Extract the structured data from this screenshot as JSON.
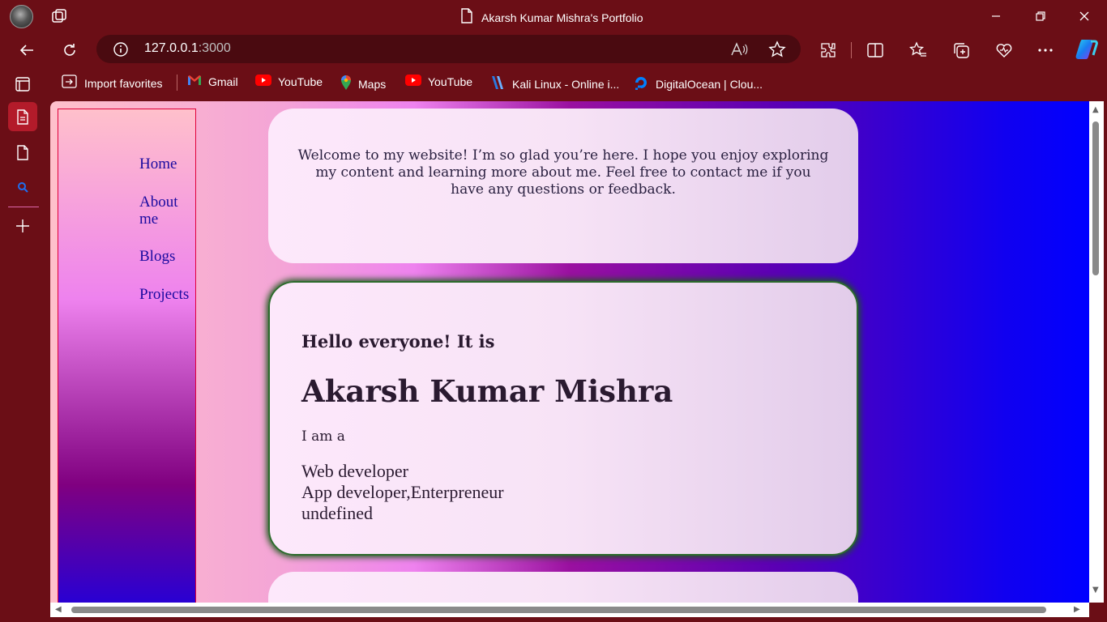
{
  "browser": {
    "tab_title": "Akarsh Kumar Mishra's Portfolio",
    "url_host": "127.0.0.1",
    "url_port": ":3000"
  },
  "favorites": [
    {
      "label": "Import favorites",
      "icon": "import-icon"
    },
    {
      "label": "Gmail",
      "icon": "gmail-icon"
    },
    {
      "label": "YouTube",
      "icon": "youtube-icon"
    },
    {
      "label": "Maps",
      "icon": "maps-icon"
    },
    {
      "label": "YouTube",
      "icon": "youtube-icon"
    },
    {
      "label": "Kali Linux - Online i...",
      "icon": "kali-icon"
    },
    {
      "label": "DigitalOcean | Clou...",
      "icon": "digitalocean-icon"
    }
  ],
  "site": {
    "nav": [
      "Home",
      "About me",
      "Blogs",
      "Projects"
    ],
    "welcome": "Welcome to my website! I’m so glad you’re here. I hope you enjoy exploring my content and learning more about me. Feel free to contact me if you have any questions or feedback.",
    "hello": "Hello everyone! It is",
    "name": "Akarsh Kumar Mishra",
    "iam": "I am a",
    "roles": [
      "Web developer",
      "App developer,Enterpreneur",
      "undefined"
    ]
  },
  "colors": {
    "browser_frame": "#6b0e16",
    "address_bar": "#4a0a10",
    "nav_link": "#1a0aa0",
    "card_border": "#2c6b2c"
  }
}
